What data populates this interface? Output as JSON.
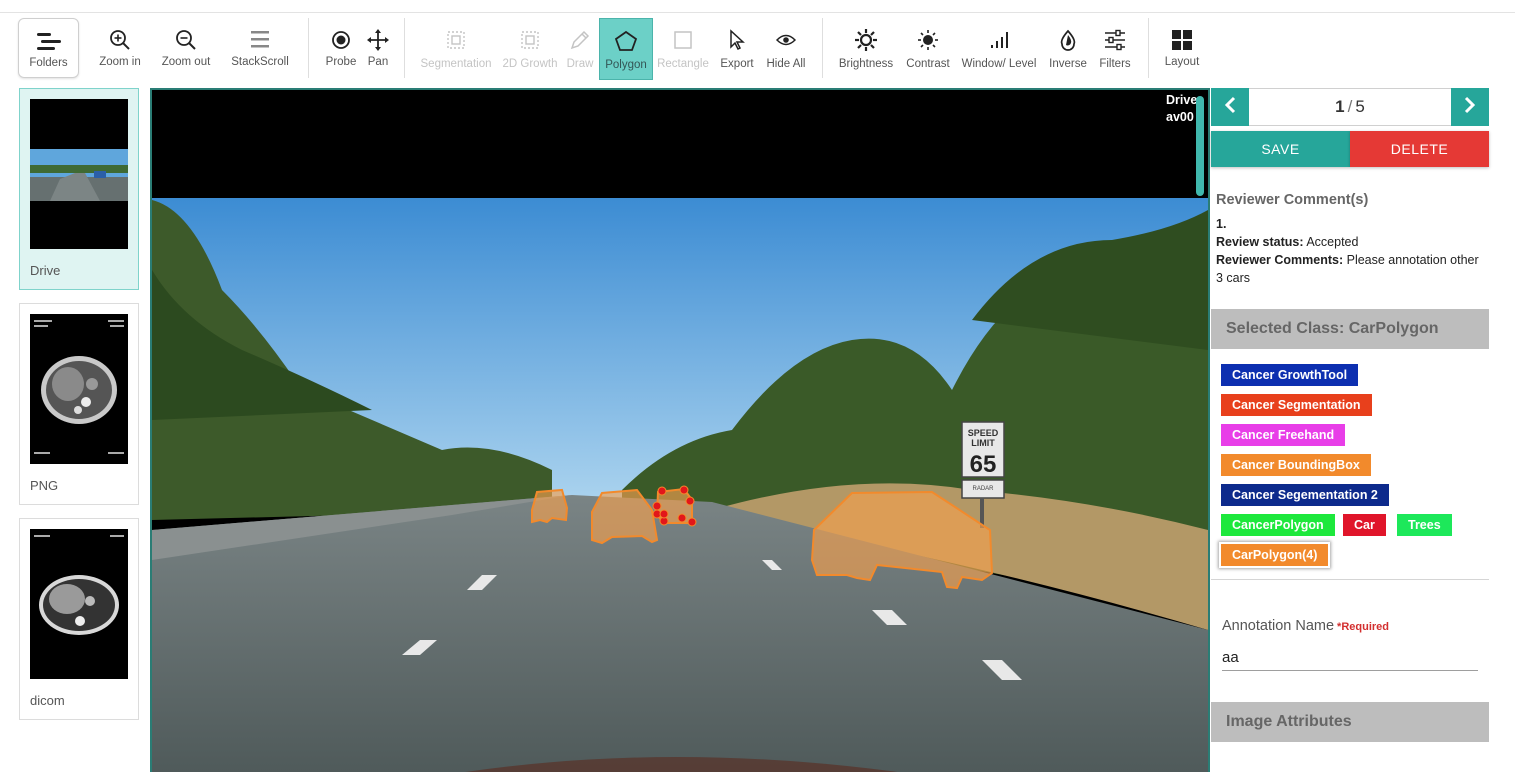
{
  "toolbar": {
    "items": [
      {
        "label": "Folders",
        "icon": "folders-icon"
      },
      {
        "label": "Zoom in",
        "icon": "zoom-in-icon"
      },
      {
        "label": "Zoom out",
        "icon": "zoom-out-icon"
      },
      {
        "label": "StackScroll",
        "icon": "stack-scroll-icon"
      },
      {
        "label": "Probe",
        "icon": "probe-icon"
      },
      {
        "label": "Pan",
        "icon": "pan-icon"
      },
      {
        "label": "Segmentation",
        "icon": "segmentation-icon",
        "disabled": true
      },
      {
        "label": "2D Growth",
        "icon": "growth-2d-icon",
        "disabled": true
      },
      {
        "label": "Draw",
        "icon": "pencil-icon",
        "disabled": true
      },
      {
        "label": "Polygon",
        "icon": "polygon-icon",
        "active": true
      },
      {
        "label": "Rectangle",
        "icon": "rectangle-icon",
        "disabled": true
      },
      {
        "label": "Export",
        "icon": "cursor-icon"
      },
      {
        "label": "Hide All",
        "icon": "eye-icon"
      },
      {
        "label": "Brightness",
        "icon": "brightness-icon"
      },
      {
        "label": "Contrast",
        "icon": "contrast-icon"
      },
      {
        "label": "Window/ Level",
        "icon": "window-level-icon"
      },
      {
        "label": "Inverse",
        "icon": "inverse-icon"
      },
      {
        "label": "Filters",
        "icon": "filters-icon"
      },
      {
        "label": "Layout",
        "icon": "layout-grid-icon"
      }
    ],
    "active_color": "#6cd0c7"
  },
  "thumbnails": [
    {
      "name": "Drive",
      "selected": true
    },
    {
      "name": "PNG",
      "selected": false
    },
    {
      "name": "dicom",
      "selected": false
    }
  ],
  "viewer": {
    "info_line1": "Drive",
    "info_line2": "av00"
  },
  "pager": {
    "current": "1",
    "total": "5",
    "prev_icon": "chevron-left-icon",
    "next_icon": "chevron-right-icon"
  },
  "actions": {
    "save_label": "SAVE",
    "delete_label": "DELETE",
    "save_color": "#26a69a",
    "delete_color": "#e53935"
  },
  "review": {
    "title": "Reviewer Comment(s)",
    "index": "1.",
    "status_label": "Review status:",
    "status_value": "Accepted",
    "comments_label": "Reviewer Comments:",
    "comments_value": "Please annotation other 3 cars"
  },
  "selected_class": {
    "title": "Selected Class: CarPolygon"
  },
  "classes": [
    {
      "label": "Cancer GrowthTool",
      "color": "#0d2fb0"
    },
    {
      "label": "Cancer Segmentation",
      "color": "#e8401c"
    },
    {
      "label": "Cancer Freehand",
      "color": "#e83ee8"
    },
    {
      "label": "Cancer BoundingBox",
      "color": "#f28a2c"
    },
    {
      "label": "Cancer Segementation 2",
      "color": "#0d2a8c"
    },
    {
      "label": "CancerPolygon",
      "color": "#1de83c"
    },
    {
      "label": "Car",
      "color": "#e0152a"
    },
    {
      "label": "Trees",
      "color": "#1de85a"
    },
    {
      "label": "CarPolygon(4)",
      "color": "#f28a2c",
      "selected": true
    }
  ],
  "annotation": {
    "label": "Annotation Name",
    "required": "*Required",
    "value": "aa"
  },
  "image_attributes": {
    "title": "Image Attributes"
  }
}
